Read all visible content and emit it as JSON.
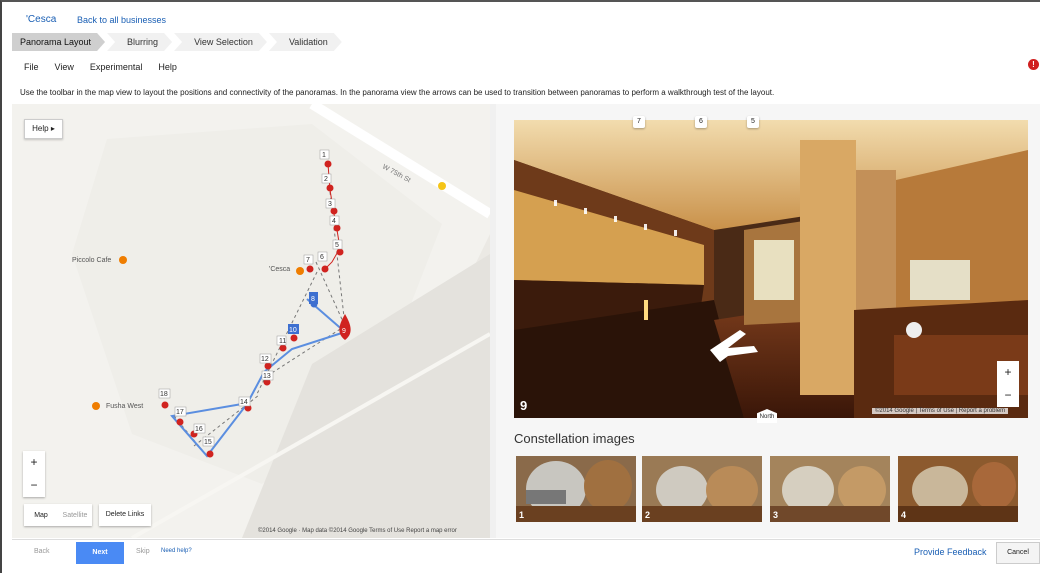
{
  "header": {
    "brand": "'Cesca",
    "back_link": "Back to all businesses"
  },
  "steps": [
    "Panorama Layout",
    "Blurring",
    "View Selection",
    "Validation"
  ],
  "menu": [
    "File",
    "View",
    "Experimental",
    "Help"
  ],
  "instructions": "Use the toolbar in the map view to layout the positions and connectivity of the panoramas. In the panorama view the arrows can be used to transition between panoramas to perform a walkthrough test of the layout.",
  "map": {
    "help_label": "Help ▸",
    "street_label": "W 75th St",
    "pois": [
      "Piccolo Cafe",
      "'Cesca",
      "Fusha West"
    ],
    "zoom_in": "+",
    "zoom_out": "−",
    "maptype": {
      "map": "Map",
      "satellite": "Satellite"
    },
    "delete_links": "Delete Links",
    "footer": "©2014 Google · Map data ©2014 Google    Terms of Use    Report a map error",
    "markers": [
      "1",
      "2",
      "3",
      "4",
      "5",
      "6",
      "7",
      "8",
      "9",
      "10",
      "11",
      "12",
      "13",
      "14",
      "15",
      "16",
      "17",
      "18"
    ]
  },
  "panorama": {
    "number": "9",
    "zoom_in": "+",
    "zoom_out": "−",
    "footer": "©2014 Google  |  Terms of Use  |  Report a problem",
    "north": "North",
    "nav_tags": [
      "7",
      "6",
      "5"
    ]
  },
  "constellation": {
    "title": "Constellation images",
    "thumbs": [
      "1",
      "2",
      "3",
      "4"
    ]
  },
  "footer": {
    "back": "Back",
    "next": "Next",
    "skip": "Skip",
    "need_help": "Need help?",
    "feedback": "Provide Feedback",
    "cancel": "Cancel"
  },
  "colors": {
    "accent": "#4a8af4",
    "marker_red": "#d0231f",
    "link_blue": "#1a5fb4",
    "alert_red": "#d02020"
  }
}
